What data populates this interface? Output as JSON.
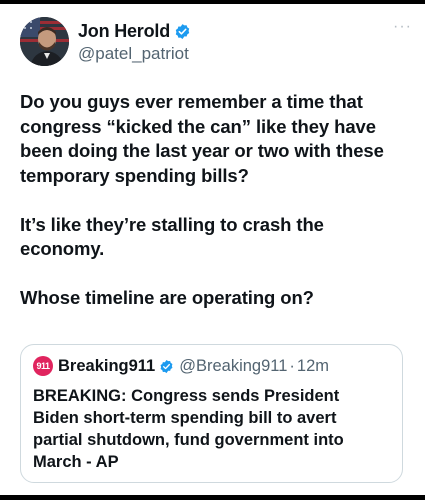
{
  "tweet": {
    "author_name": "Jon Herold",
    "author_handle": "@patel_patriot",
    "more_label": "···",
    "body": "Do you guys ever remember a time that congress “kicked the can” like they have been doing the last year or two with these temporary spending bills?\n\nIt’s like they’re stalling to crash the economy.\n\nWhose timeline are operating on?"
  },
  "quoted_tweet": {
    "avatar_text": "911",
    "author_name": "Breaking911",
    "author_handle": "@Breaking911",
    "separator": "·",
    "time": "12m",
    "body": "BREAKING: Congress sends President Biden short-term spending bill to avert partial shutdown, fund government into March - AP"
  },
  "colors": {
    "verified": "#1d9bf0",
    "secondary_text": "#536471",
    "border": "#cfd9de",
    "breaking911_brand": "#e0245e"
  },
  "icons": [
    "verified-badge-icon",
    "more-options-icon"
  ]
}
